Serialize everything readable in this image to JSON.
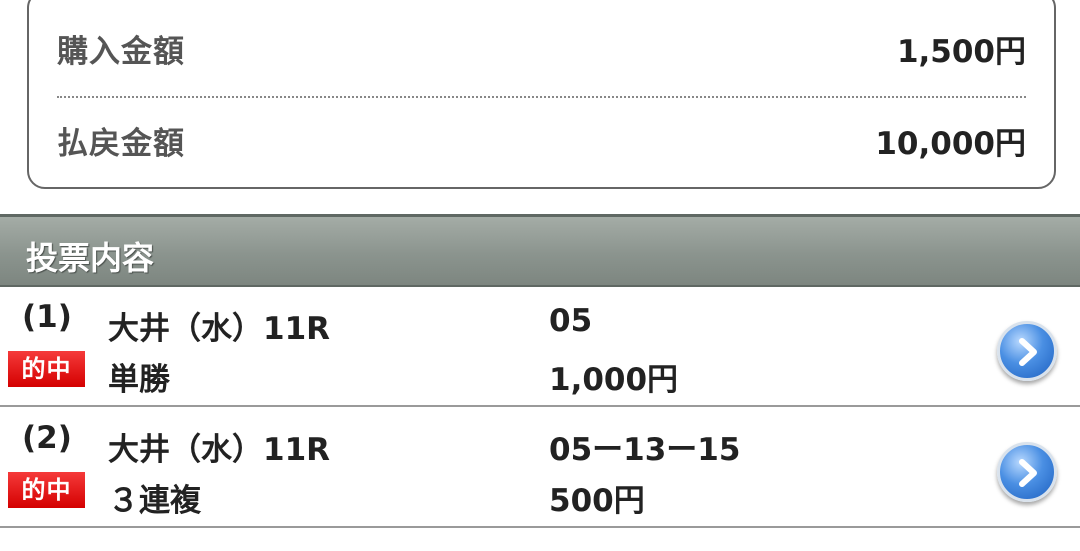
{
  "summary": {
    "purchase_label": "購入金額",
    "purchase_value": "1,500円",
    "payout_label": "払戻金額",
    "payout_value": "10,000円"
  },
  "section": {
    "title": "投票内容"
  },
  "bets": [
    {
      "index": "(1)",
      "badge": "的中",
      "race": "大井（水）11R",
      "type": "単勝",
      "numbers": "05",
      "amount": "1,000円",
      "icon": "chevron-right-icon"
    },
    {
      "index": "(2)",
      "badge": "的中",
      "race": "大井（水）11R",
      "type": "３連複",
      "numbers": "05ー13ー15",
      "amount": "500円",
      "icon": "chevron-right-icon"
    }
  ],
  "colors": {
    "badge_red": "#d40000",
    "header_gray": "#8b948e",
    "button_blue": "#1c5fbf"
  }
}
